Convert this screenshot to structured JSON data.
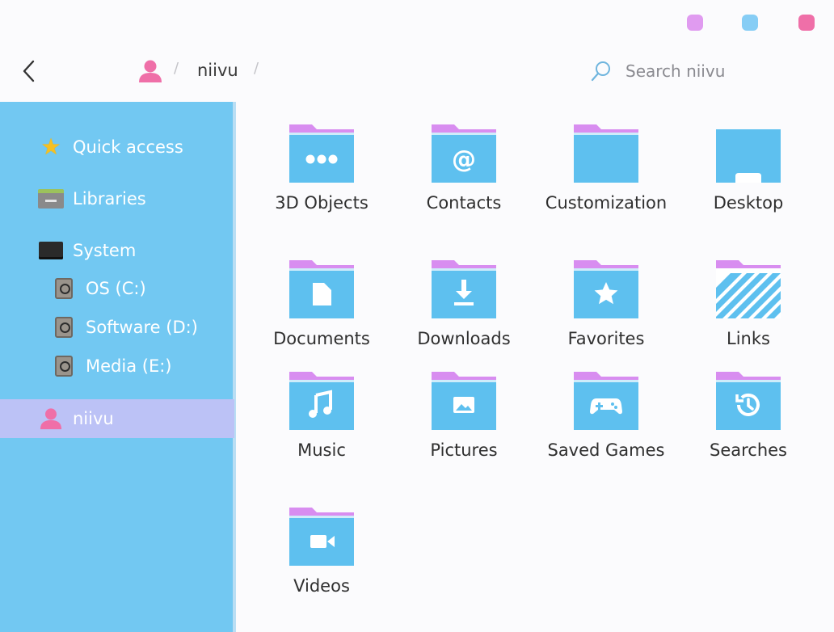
{
  "window": {
    "colors": {
      "minimize": "#e09bf0",
      "maximize": "#86cdf5",
      "close": "#ef6fa8"
    }
  },
  "nav": {
    "breadcrumb": {
      "user": "niivu",
      "separator": "/"
    },
    "search": {
      "placeholder": "Search niivu",
      "value": ""
    }
  },
  "sidebar": {
    "items": [
      {
        "label": "Quick access",
        "icon": "star-icon"
      },
      {
        "label": "Libraries",
        "icon": "library-icon"
      },
      {
        "label": "System",
        "icon": "computer-icon"
      },
      {
        "label": "OS (C:)",
        "icon": "drive-icon"
      },
      {
        "label": "Software (D:)",
        "icon": "drive-icon"
      },
      {
        "label": "Media (E:)",
        "icon": "drive-icon"
      },
      {
        "label": "niivu",
        "icon": "user-icon",
        "selected": true
      }
    ]
  },
  "folders": [
    {
      "label": "3D Objects",
      "icon": "dots-icon"
    },
    {
      "label": "Contacts",
      "icon": "at-icon"
    },
    {
      "label": "Customization",
      "icon": ""
    },
    {
      "label": "Desktop",
      "icon": "desktop-icon"
    },
    {
      "label": "Documents",
      "icon": "document-icon"
    },
    {
      "label": "Downloads",
      "icon": "download-icon"
    },
    {
      "label": "Favorites",
      "icon": "star-icon"
    },
    {
      "label": "Links",
      "icon": "stripes-icon"
    },
    {
      "label": "Music",
      "icon": "music-icon"
    },
    {
      "label": "Pictures",
      "icon": "picture-icon"
    },
    {
      "label": "Saved Games",
      "icon": "gamepad-icon"
    },
    {
      "label": "Searches",
      "icon": "history-icon"
    },
    {
      "label": "Videos",
      "icon": "video-icon"
    }
  ],
  "theme": {
    "sidebar_bg": "#72c8f2",
    "folder_body": "#5ec0ef",
    "folder_tab": "#d88df0",
    "selected_bg": "#bcc2f6",
    "user_pink": "#ef6fa8"
  }
}
